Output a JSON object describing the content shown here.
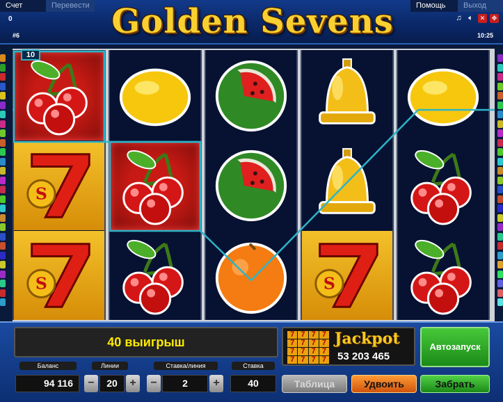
{
  "header": {
    "tab_account": "Счет",
    "tab_transfer": "Перевести",
    "tab_help": "Помощь",
    "tab_exit": "Выход",
    "account_value": "0",
    "game_number": "#6",
    "title": "Golden Sevens",
    "clock": "10:25"
  },
  "reels": {
    "win_badge": "10",
    "columns": [
      [
        "cherry",
        "seven",
        "seven"
      ],
      [
        "lemon",
        "cherry",
        "cherry"
      ],
      [
        "watermelon",
        "watermelon",
        "orange"
      ],
      [
        "bell",
        "bell",
        "seven"
      ],
      [
        "lemon",
        "cherry",
        "cherry"
      ]
    ]
  },
  "message": "40 выигрыш",
  "jackpot": {
    "title": "Jackpot",
    "value": "53 203 465"
  },
  "buttons": {
    "autostart": "Автозапуск",
    "table": "Таблица",
    "double": "Удвоить",
    "take": "Забрать"
  },
  "labels": {
    "balance": "Баланс",
    "lines": "Линии",
    "bet_line": "Ставка/линия",
    "bet": "Ставка"
  },
  "values": {
    "balance": "94 116",
    "lines": "20",
    "bet_line": "2",
    "bet": "40"
  },
  "colors": {
    "payline": "#2db4c7",
    "accent_gold": "#f9d030",
    "autostart_green": "#1b8a18"
  }
}
